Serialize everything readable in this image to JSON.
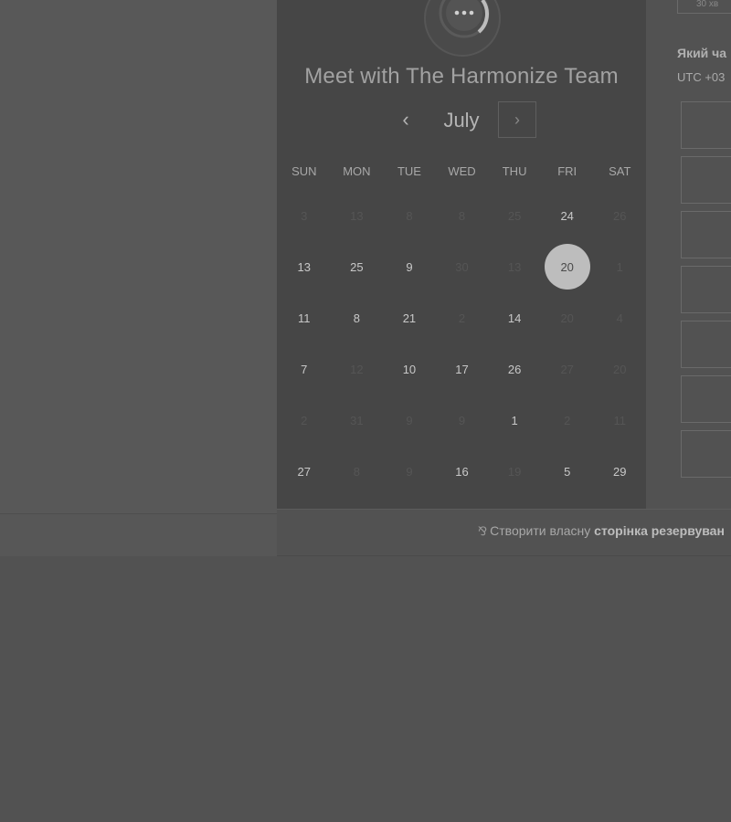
{
  "calendar": {
    "title": "Meet with The Harmonize Team",
    "month": "July",
    "prev_symbol": "‹",
    "next_symbol": "›",
    "weekdays": [
      "SUN",
      "MON",
      "TUE",
      "WED",
      "THU",
      "FRI",
      "SAT"
    ],
    "weeks": [
      [
        {
          "d": "3",
          "m": true
        },
        {
          "d": "13",
          "m": true
        },
        {
          "d": "8",
          "m": true
        },
        {
          "d": "8",
          "m": true
        },
        {
          "d": "25",
          "m": true
        },
        {
          "d": "24",
          "m": false
        },
        {
          "d": "26",
          "m": true
        }
      ],
      [
        {
          "d": "13",
          "m": false
        },
        {
          "d": "25",
          "m": false
        },
        {
          "d": "9",
          "m": false
        },
        {
          "d": "30",
          "m": true
        },
        {
          "d": "13",
          "m": true
        },
        {
          "d": "20",
          "m": false,
          "selected": true
        },
        {
          "d": "1",
          "m": true
        }
      ],
      [
        {
          "d": "11",
          "m": false
        },
        {
          "d": "8",
          "m": false
        },
        {
          "d": "21",
          "m": false
        },
        {
          "d": "2",
          "m": true
        },
        {
          "d": "14",
          "m": false
        },
        {
          "d": "20",
          "m": true
        },
        {
          "d": "4",
          "m": true
        }
      ],
      [
        {
          "d": "7",
          "m": false
        },
        {
          "d": "12",
          "m": true
        },
        {
          "d": "10",
          "m": false
        },
        {
          "d": "17",
          "m": false
        },
        {
          "d": "26",
          "m": false
        },
        {
          "d": "27",
          "m": true
        },
        {
          "d": "20",
          "m": true
        }
      ],
      [
        {
          "d": "2",
          "m": true
        },
        {
          "d": "31",
          "m": true
        },
        {
          "d": "9",
          "m": true
        },
        {
          "d": "9",
          "m": true
        },
        {
          "d": "1",
          "m": false
        },
        {
          "d": "2",
          "m": true
        },
        {
          "d": "11",
          "m": true
        }
      ],
      [
        {
          "d": "27",
          "m": false
        },
        {
          "d": "8",
          "m": true
        },
        {
          "d": "9",
          "m": true
        },
        {
          "d": "16",
          "m": false
        },
        {
          "d": "19",
          "m": true
        },
        {
          "d": "5",
          "m": false
        },
        {
          "d": "29",
          "m": false
        }
      ]
    ]
  },
  "right_panel": {
    "duration_label": "30 хв",
    "question": "Який ча",
    "timezone": "UTC +03",
    "slot_count": 7
  },
  "footer": {
    "icon": "hubspot-sprocket-icon",
    "text_prefix": "Створити власну",
    "text_bold": "сторінка резервуван"
  },
  "colors": {
    "overlay_bg": "#525252",
    "card_bg": "#464646",
    "selected_day": "#bdbdbd"
  }
}
